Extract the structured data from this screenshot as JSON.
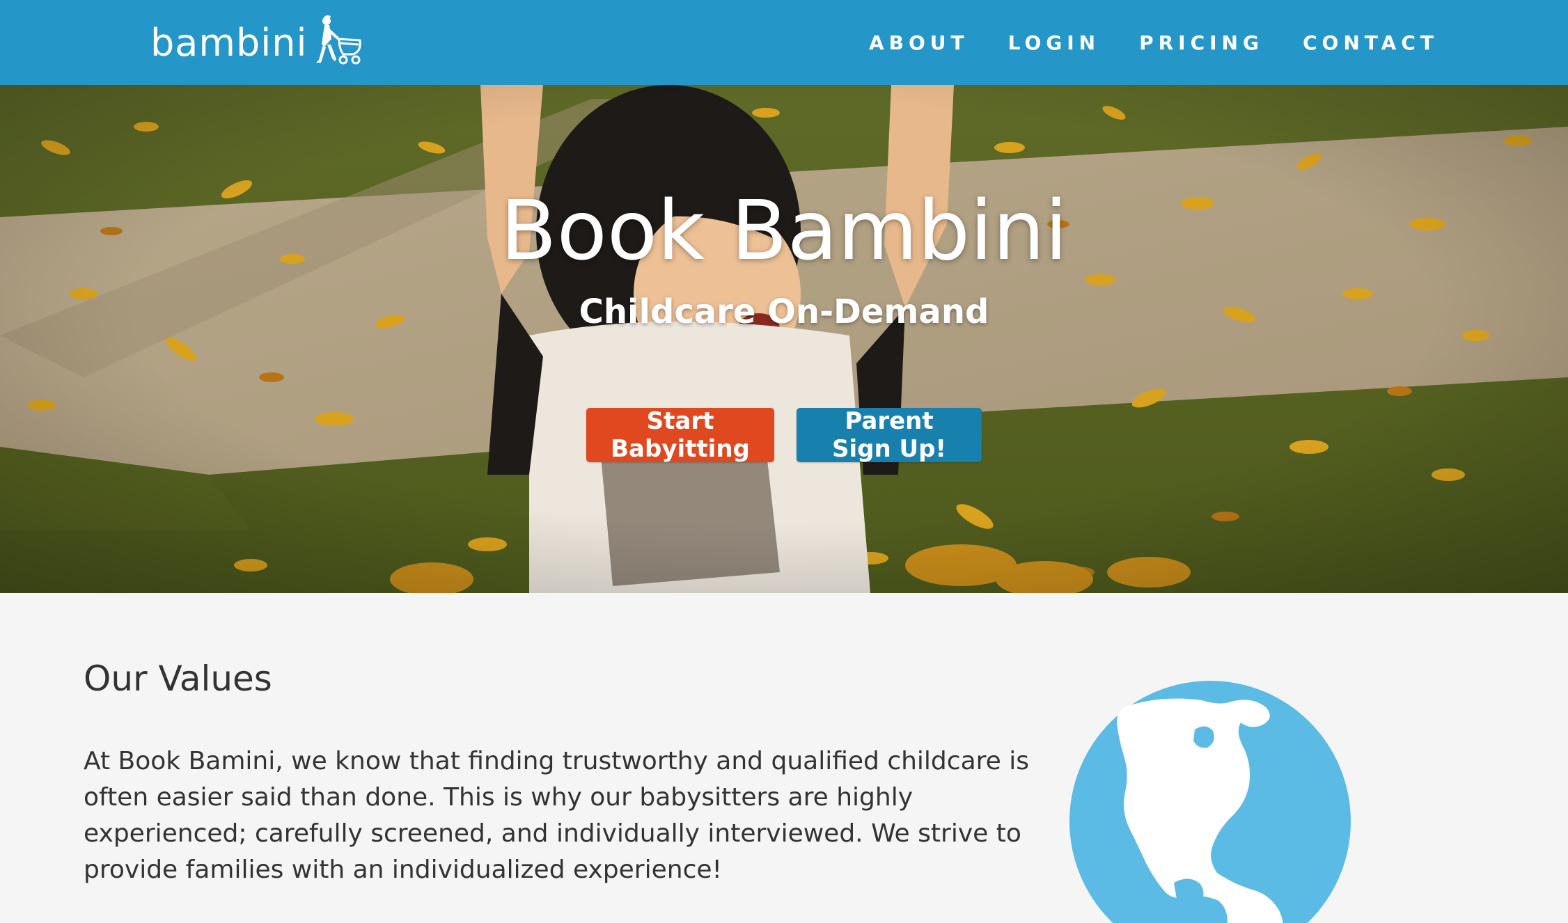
{
  "brand": {
    "name": "bambini",
    "icon": "mother-stroller-icon"
  },
  "nav": {
    "items": [
      {
        "label": "ABOUT"
      },
      {
        "label": "LOGIN"
      },
      {
        "label": "PRICING"
      },
      {
        "label": "CONTACT"
      }
    ]
  },
  "hero": {
    "title": "Book Bambini",
    "subtitle": "Childcare On-Demand",
    "buttons": {
      "sitter_label": "Start Babyitting",
      "parent_label": "Parent Sign Up!"
    }
  },
  "values": {
    "heading": "Our Values",
    "body": "At Book Bamini, we know that finding trustworthy and qualified childcare is often easier said than done. This is why our babysitters are highly experienced; carefully screened, and individually interviewed. We strive to provide families with an individualized experience!",
    "icon": "globe-icon"
  },
  "colors": {
    "navbar": "#2496c8",
    "sitter_button": "#e0491f",
    "parent_button": "#1780ad",
    "globe": "#5bbbe4",
    "section_bg": "#f5f5f5",
    "text": "#333333"
  }
}
